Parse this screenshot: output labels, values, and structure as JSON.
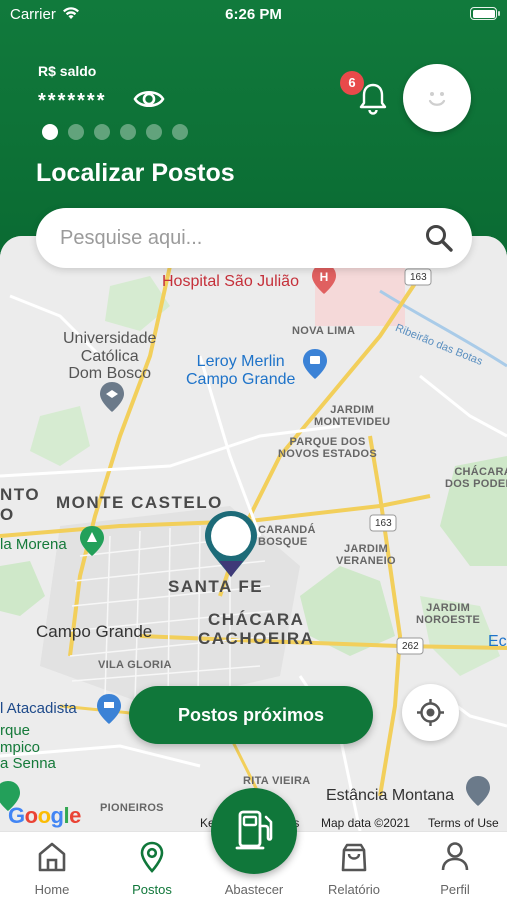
{
  "status_bar": {
    "carrier": "Carrier",
    "time": "6:26 PM"
  },
  "header": {
    "balance_label": "R$ saldo",
    "balance_hidden": "*******",
    "carousel_dots": 6,
    "carousel_active_index": 0,
    "title": "Localizar Postos",
    "notification_count": "6"
  },
  "search": {
    "placeholder": "Pesquise aqui..."
  },
  "map": {
    "labels": {
      "hospital": "Hospital São Julião",
      "university": "Universidade\nCatólica\nDom Bosco",
      "nova_lima": "NOVA LIMA",
      "ribeirao": "Ribeirão das Botas",
      "leroy": "Leroy Merlin\nCampo Grande",
      "jardim_montevideu": "JARDIM\nMONTEVIDEU",
      "parque_novos_estados": "PARQUE DOS\nNOVOS ESTADOS",
      "chacara_poderes": "CHÁCARA\nDOS PODERE",
      "monte_castelo": "MONTE CASTELO",
      "onto": "NTO",
      "o_small": "O",
      "caranda_bosque": "CARANDÁ\nBOSQUE",
      "la_morena": "la Morena",
      "jardim_veraneio": "JARDIM\nVERANEIO",
      "santa_fe": "SANTA FE",
      "chacara_cachoeira": "CHÁCARA\nCACHOEIRA",
      "campo_grande": "Campo Grande",
      "jardim_noroeste": "JARDIM\nNOROESTE",
      "vila_gloria": "VILA GLORIA",
      "atacadista": "l Atacadista",
      "ec": "Ec",
      "olimpico": "rque\nmpico\na Senna",
      "rita_vieira": "RITA VIEIRA",
      "pioneiros": "PIONEIROS",
      "estancia": "Estância Montana",
      "road_163_top": "163",
      "road_163_mid": "163",
      "road_262": "262"
    }
  },
  "buttons": {
    "nearby": "Postos próximos"
  },
  "attribution": {
    "keys": "Ke",
    "keys_tail": "ts",
    "map_data": "Map data ©2021",
    "terms": "Terms of Use",
    "google": "Google"
  },
  "tabs": [
    {
      "label": "Home"
    },
    {
      "label": "Postos"
    },
    {
      "label": "Abastecer"
    },
    {
      "label": "Relatório"
    },
    {
      "label": "Perfil"
    }
  ],
  "colors": {
    "brand": "#10773a",
    "badge": "#e84a4a",
    "search_placeholder": "#9b9b9b"
  }
}
